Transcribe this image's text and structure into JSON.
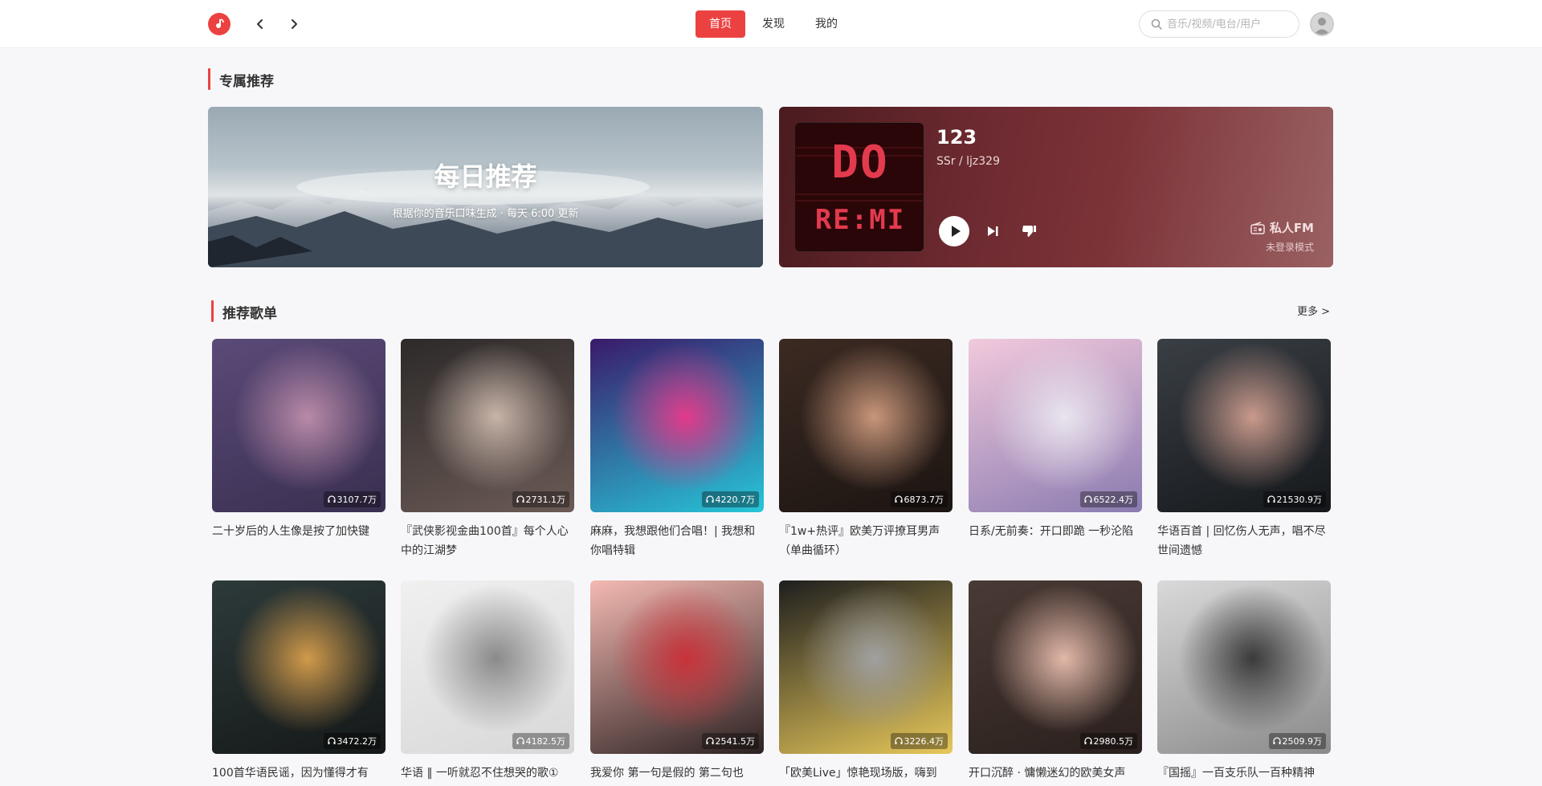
{
  "header": {
    "tabs": [
      "首页",
      "发现",
      "我的"
    ],
    "search_placeholder": "音乐/视频/电台/用户"
  },
  "exclusive": {
    "title": "专属推荐",
    "daily_title": "每日推荐",
    "daily_subtitle": "根据你的音乐口味生成 · 每天 6:00 更新"
  },
  "fm": {
    "cover_top": "DO",
    "cover_bottom": "RE:MI",
    "song": "123",
    "artist": "SSr / ljz329",
    "label": "私人FM",
    "mode": "未登录模式"
  },
  "playlists_section": {
    "title": "推荐歌单",
    "more": "更多 >"
  },
  "playlists": [
    {
      "name": "二十岁后的人生像是按了加快键",
      "count": "3107.7万",
      "colors": [
        "#5a4a78",
        "#b98aa8",
        "#3a2f50"
      ]
    },
    {
      "name": "『武侠影视金曲100首』每个人心中的江湖梦",
      "count": "2731.1万",
      "colors": [
        "#2d2a2a",
        "#c7b4a8",
        "#6b5a55"
      ]
    },
    {
      "name": "麻麻，我想跟他们合唱！| 我想和你唱特辑",
      "count": "4220.7万",
      "colors": [
        "#3a1a6a",
        "#e23a8a",
        "#27c6d8"
      ]
    },
    {
      "name": "『1w+热评』欧美万评撩耳男声（单曲循环）",
      "count": "6873.7万",
      "colors": [
        "#3b2a22",
        "#c8967a",
        "#1c1512"
      ]
    },
    {
      "name": "日系/无前奏：开口即跪 一秒沦陷",
      "count": "6522.4万",
      "colors": [
        "#f2c9dc",
        "#e8e4ee",
        "#8a7bb0"
      ]
    },
    {
      "name": "华语百首 | 回忆伤人无声，唱不尽世间遗憾",
      "count": "21530.9万",
      "colors": [
        "#3a3f45",
        "#c99a8c",
        "#15181b"
      ]
    },
    {
      "name": "100首华语民谣，因为懂得才有",
      "count": "3472.2万",
      "colors": [
        "#2d3a3a",
        "#d19a4a",
        "#151818"
      ]
    },
    {
      "name": "华语 ‖ 一听就忍不住想哭的歌①",
      "count": "4182.5万",
      "colors": [
        "#f0f0f0",
        "#8a8a8a",
        "#d8d8d8"
      ]
    },
    {
      "name": "我爱你 第一句是假的 第二句也",
      "count": "2541.5万",
      "colors": [
        "#f4b9b2",
        "#c8323a",
        "#2b2121"
      ]
    },
    {
      "name": "「欧美Live」惊艳现场版，嗨到",
      "count": "3226.4万",
      "colors": [
        "#1e1e1e",
        "#a0a0a0",
        "#e7c85a"
      ]
    },
    {
      "name": "开口沉醉 · 慵懒迷幻的欧美女声",
      "count": "2980.5万",
      "colors": [
        "#4a3a35",
        "#e2b8a8",
        "#2a201d"
      ]
    },
    {
      "name": "『国摇』一百支乐队一百种精神",
      "count": "2509.9万",
      "colors": [
        "#d9d9d9",
        "#3a3a3a",
        "#8a8a8a"
      ]
    }
  ]
}
